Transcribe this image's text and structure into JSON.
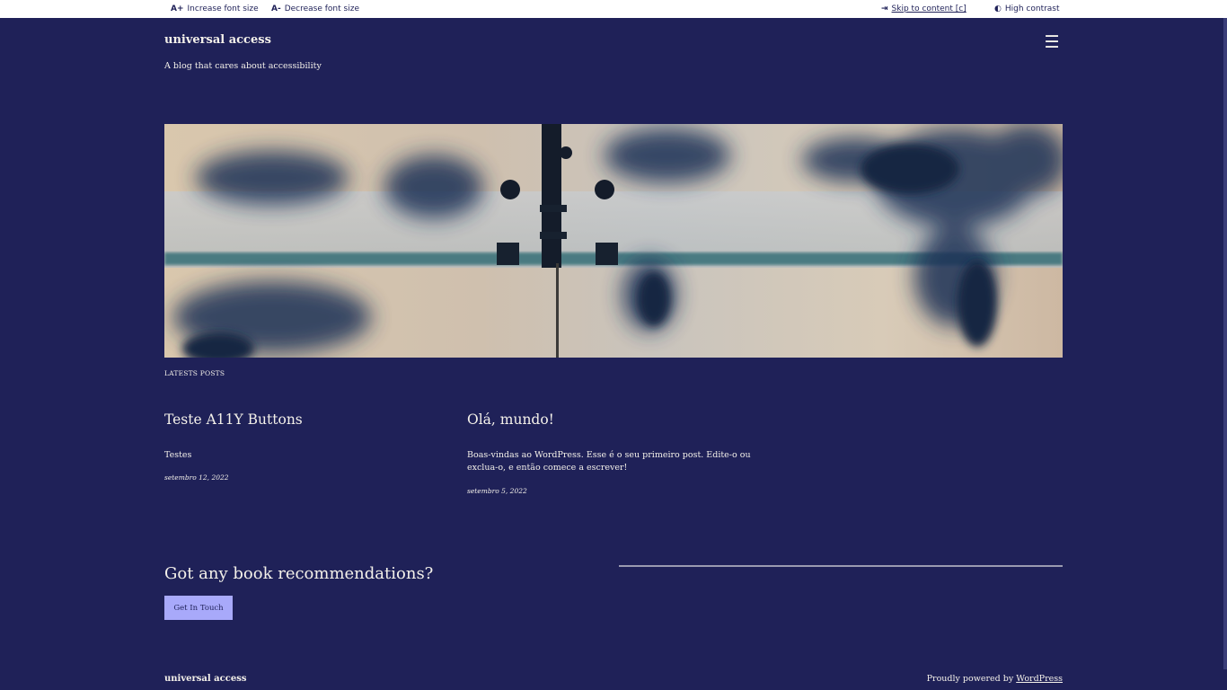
{
  "a11y_toolbar": {
    "increase_icon": "A+",
    "increase_label": "Increase font size",
    "decrease_icon": "A-",
    "decrease_label": "Decrease font size",
    "skip_icon": "⇥",
    "skip_label": "Skip to content [c]",
    "contrast_icon": "◐",
    "contrast_label": "High contrast"
  },
  "header": {
    "site_title": "universal access",
    "tagline": "A blog that cares about accessibility",
    "menu_icon": "☰"
  },
  "hero": {
    "image": "hands-on-frosted-glass-photo"
  },
  "latest_posts": {
    "heading": "LATESTS POSTS",
    "posts": [
      {
        "title": "Teste A11Y Buttons",
        "excerpt": "Testes",
        "date": "setembro 12, 2022"
      },
      {
        "title": "Olá, mundo!",
        "excerpt": "Boas-vindas ao WordPress. Esse é o seu primeiro post. Edite-o ou exclua-o, e então comece a escrever!",
        "date": "setembro 5, 2022"
      }
    ]
  },
  "cta": {
    "heading": "Got any book recommendations?",
    "button_label": "Get In Touch"
  },
  "footer": {
    "site_title": "universal access",
    "powered_prefix": "Proudly powered by ",
    "powered_link": "WordPress"
  },
  "colors": {
    "background": "#1f2158",
    "text": "#f4f1ea",
    "button": "#a8a9fa",
    "toolbar": "#ffffff"
  }
}
